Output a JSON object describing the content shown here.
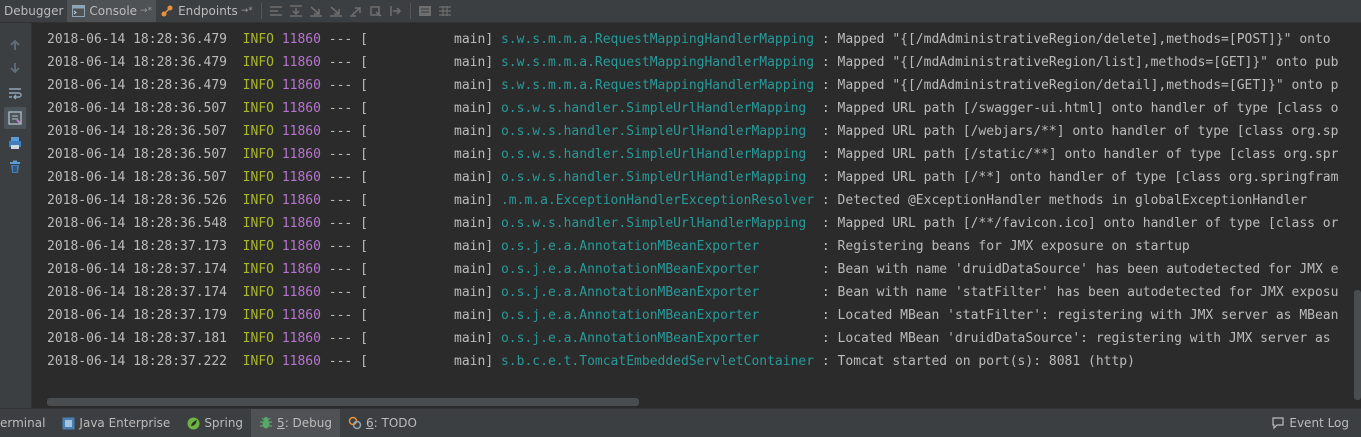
{
  "toolbar": {
    "tabs": [
      {
        "label": "Debugger"
      },
      {
        "label": "Console",
        "pin": "→*"
      },
      {
        "label": "Endpoints",
        "pin": "→*"
      }
    ]
  },
  "console": {
    "lines": [
      {
        "ts": "2018-06-14 18:28:36.479",
        "level": "INFO",
        "pid": "11860",
        "sep": "---",
        "thread": "[           main]",
        "logger": "s.w.s.m.m.a.RequestMappingHandlerMapping",
        "msg": ": Mapped \"{[/mdAdministrativeRegion/delete],methods=[POST]}\" onto"
      },
      {
        "ts": "2018-06-14 18:28:36.479",
        "level": "INFO",
        "pid": "11860",
        "sep": "---",
        "thread": "[           main]",
        "logger": "s.w.s.m.m.a.RequestMappingHandlerMapping",
        "msg": ": Mapped \"{[/mdAdministrativeRegion/list],methods=[GET]}\" onto pub"
      },
      {
        "ts": "2018-06-14 18:28:36.479",
        "level": "INFO",
        "pid": "11860",
        "sep": "---",
        "thread": "[           main]",
        "logger": "s.w.s.m.m.a.RequestMappingHandlerMapping",
        "msg": ": Mapped \"{[/mdAdministrativeRegion/detail],methods=[GET]}\" onto p"
      },
      {
        "ts": "2018-06-14 18:28:36.507",
        "level": "INFO",
        "pid": "11860",
        "sep": "---",
        "thread": "[           main]",
        "logger": "o.s.w.s.handler.SimpleUrlHandlerMapping ",
        "msg": ": Mapped URL path [/swagger-ui.html] onto handler of type [class o"
      },
      {
        "ts": "2018-06-14 18:28:36.507",
        "level": "INFO",
        "pid": "11860",
        "sep": "---",
        "thread": "[           main]",
        "logger": "o.s.w.s.handler.SimpleUrlHandlerMapping ",
        "msg": ": Mapped URL path [/webjars/**] onto handler of type [class org.sp"
      },
      {
        "ts": "2018-06-14 18:28:36.507",
        "level": "INFO",
        "pid": "11860",
        "sep": "---",
        "thread": "[           main]",
        "logger": "o.s.w.s.handler.SimpleUrlHandlerMapping ",
        "msg": ": Mapped URL path [/static/**] onto handler of type [class org.spr"
      },
      {
        "ts": "2018-06-14 18:28:36.507",
        "level": "INFO",
        "pid": "11860",
        "sep": "---",
        "thread": "[           main]",
        "logger": "o.s.w.s.handler.SimpleUrlHandlerMapping ",
        "msg": ": Mapped URL path [/**] onto handler of type [class org.springfram"
      },
      {
        "ts": "2018-06-14 18:28:36.526",
        "level": "INFO",
        "pid": "11860",
        "sep": "---",
        "thread": "[           main]",
        "logger": ".m.m.a.ExceptionHandlerExceptionResolver",
        "msg": ": Detected @ExceptionHandler methods in globalExceptionHandler"
      },
      {
        "ts": "2018-06-14 18:28:36.548",
        "level": "INFO",
        "pid": "11860",
        "sep": "---",
        "thread": "[           main]",
        "logger": "o.s.w.s.handler.SimpleUrlHandlerMapping ",
        "msg": ": Mapped URL path [/**/favicon.ico] onto handler of type [class or"
      },
      {
        "ts": "2018-06-14 18:28:37.173",
        "level": "INFO",
        "pid": "11860",
        "sep": "---",
        "thread": "[           main]",
        "logger": "o.s.j.e.a.AnnotationMBeanExporter       ",
        "msg": ": Registering beans for JMX exposure on startup"
      },
      {
        "ts": "2018-06-14 18:28:37.174",
        "level": "INFO",
        "pid": "11860",
        "sep": "---",
        "thread": "[           main]",
        "logger": "o.s.j.e.a.AnnotationMBeanExporter       ",
        "msg": ": Bean with name 'druidDataSource' has been autodetected for JMX e"
      },
      {
        "ts": "2018-06-14 18:28:37.174",
        "level": "INFO",
        "pid": "11860",
        "sep": "---",
        "thread": "[           main]",
        "logger": "o.s.j.e.a.AnnotationMBeanExporter       ",
        "msg": ": Bean with name 'statFilter' has been autodetected for JMX exposu"
      },
      {
        "ts": "2018-06-14 18:28:37.179",
        "level": "INFO",
        "pid": "11860",
        "sep": "---",
        "thread": "[           main]",
        "logger": "o.s.j.e.a.AnnotationMBeanExporter       ",
        "msg": ": Located MBean 'statFilter': registering with JMX server as MBean"
      },
      {
        "ts": "2018-06-14 18:28:37.181",
        "level": "INFO",
        "pid": "11860",
        "sep": "---",
        "thread": "[           main]",
        "logger": "o.s.j.e.a.AnnotationMBeanExporter       ",
        "msg": ": Located MBean 'druidDataSource': registering with JMX server as"
      },
      {
        "ts": "2018-06-14 18:28:37.222",
        "level": "INFO",
        "pid": "11860",
        "sep": "---",
        "thread": "[           main]",
        "logger": "s.b.c.e.t.TomcatEmbeddedServletContainer",
        "msg": ": Tomcat started on port(s): 8081 (http)"
      }
    ]
  },
  "statusbar": {
    "terminal": "erminal",
    "java_enterprise": "Java Enterprise",
    "spring": "Spring",
    "debug_num": "5",
    "debug_label": ": Debug",
    "todo_num": "6",
    "todo_label": ": TODO",
    "event_log": "Event Log"
  },
  "colors": {
    "background": "#2b2b2b",
    "panel": "#3c3f41",
    "text": "#bbbbbb",
    "info": "#a9b72e",
    "pid": "#b774cf",
    "logger": "#299999"
  }
}
